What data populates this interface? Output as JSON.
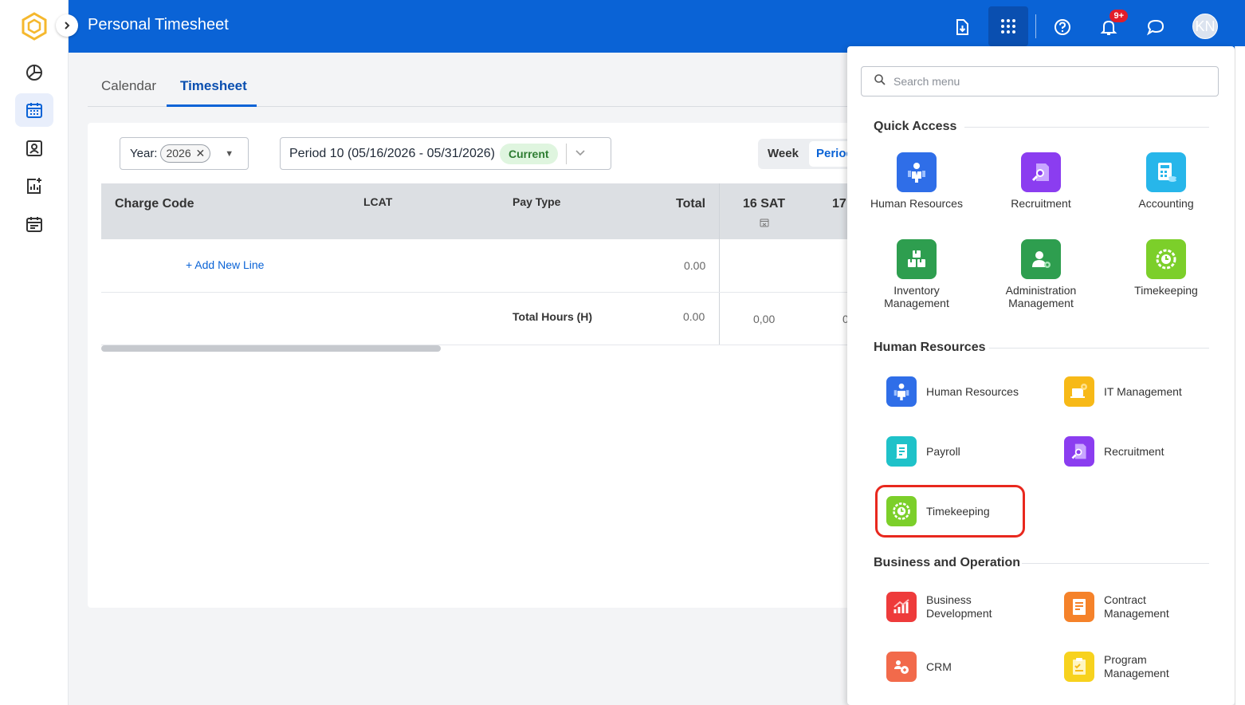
{
  "header": {
    "title": "Personal Timesheet",
    "notification_badge": "9+",
    "avatar_initials": "KN"
  },
  "tabs": [
    {
      "label": "Calendar",
      "active": false
    },
    {
      "label": "Timesheet",
      "active": true
    }
  ],
  "filters": {
    "year_label": "Year:",
    "year_value": "2026",
    "period_value": "Period 10 (05/16/2026 - 05/31/2026)",
    "period_status": "Current",
    "view_week": "Week",
    "view_period": "Period"
  },
  "table": {
    "headers": {
      "charge_code": "Charge Code",
      "lcat": "LCAT",
      "pay_type": "Pay Type",
      "total": "Total",
      "day1": "16 SAT",
      "day2": "17"
    },
    "add_line": "Add New Line",
    "add_line_total": "0.00",
    "total_hours_label": "Total Hours (H)",
    "total_hours_value": "0.00",
    "day1_total": "0,00",
    "day2_total": "0"
  },
  "menu": {
    "search_placeholder": "Search menu",
    "quick_access_title": "Quick Access",
    "quick_access": [
      {
        "label": "Human Resources"
      },
      {
        "label": "Recruitment"
      },
      {
        "label": "Accounting"
      },
      {
        "label": "Inventory Management"
      },
      {
        "label": "Administration Management"
      },
      {
        "label": "Timekeeping"
      }
    ],
    "hr_title": "Human Resources",
    "hr_items": [
      {
        "label": "Human Resources"
      },
      {
        "label": "IT Management"
      },
      {
        "label": "Payroll"
      },
      {
        "label": "Recruitment"
      },
      {
        "label": "Timekeeping"
      }
    ],
    "bo_title": "Business and Operation",
    "bo_items": [
      {
        "label": "Business Development"
      },
      {
        "label": "Contract Management"
      },
      {
        "label": "CRM"
      },
      {
        "label": "Program Management"
      }
    ]
  },
  "colors": {
    "header_blue": "#0a63d6",
    "accent_red": "#e8281e"
  }
}
